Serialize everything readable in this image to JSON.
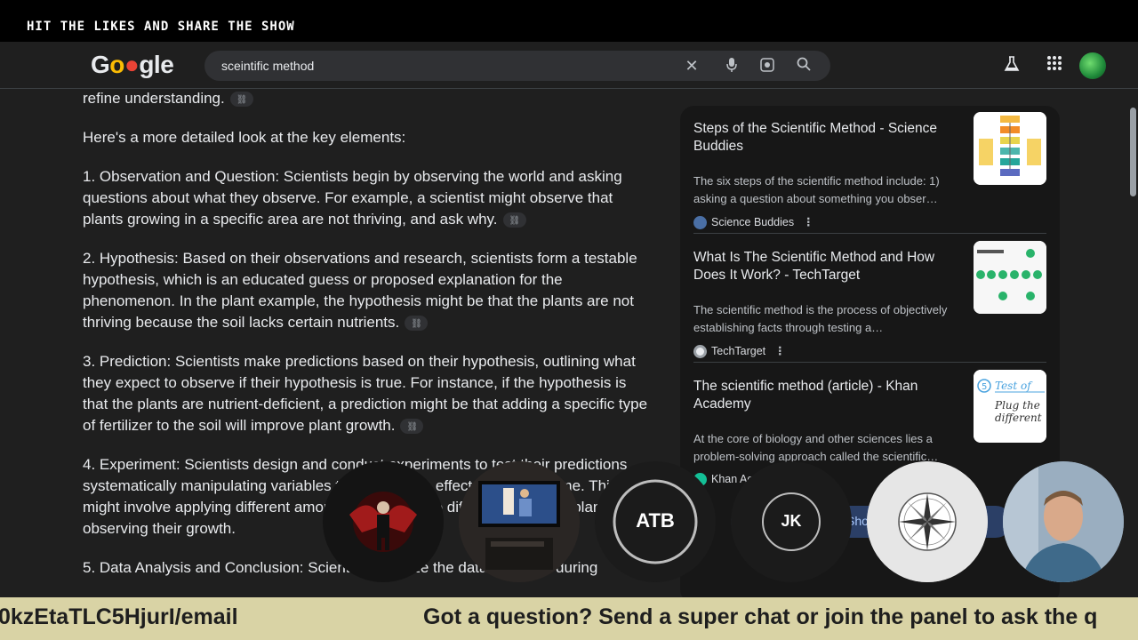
{
  "stream": {
    "banner": "HIT THE LIKES AND SHARE THE SHOW",
    "ticker_left": "0kzEtaTLC5HjurI/email",
    "ticker_right": "Got a question? Send a super chat or join the panel to ask the q"
  },
  "header": {
    "logo_text": "Google",
    "search_value": "sceintific method",
    "icons": [
      "close-icon",
      "mic-icon",
      "lens-icon",
      "search-icon",
      "labs-flask-icon",
      "apps-grid-icon",
      "account-avatar"
    ]
  },
  "main": {
    "paragraphs": [
      "refine understanding.",
      "Here's a more detailed look at the key elements:",
      "1. Observation and Question: Scientists begin by observing the world and asking questions about what they observe. For example, a scientist might observe that plants growing in a specific area are not thriving, and ask why.",
      "2. Hypothesis: Based on their observations and research, scientists form a testable hypothesis, which is an educated guess or proposed explanation for the phenomenon. In the plant example, the hypothesis might be that the plants are not thriving because the soil lacks certain nutrients.",
      "3. Prediction: Scientists make predictions based on their hypothesis, outlining what they expect to observe if their hypothesis is true. For instance, if the hypothesis is that the plants are nutrient-deficient, a prediction might be that adding a specific type of fertilizer to the soil will improve plant growth.",
      "4. Experiment: Scientists design and conduct experiments to test their predictions, systematically manipulating variables to observe the effect on the outcome. This might involve applying different amounts of fertilizer to different groups of plants and observing their growth.",
      "5. Data Analysis and Conclusion: Scientists analyze the data collected during"
    ]
  },
  "sources": [
    {
      "title": "Steps of the Scientific Method - Science Buddies",
      "snippet": "The six steps of the scientific method include: 1) asking a question about something you obser…",
      "site": "Science Buddies",
      "icon_color": "#4a6fa5"
    },
    {
      "title": "What Is The Scientific Method and How Does It Work? - TechTarget",
      "snippet": "The scientific method is the process of objectively establishing facts through testing a…",
      "site": "TechTarget",
      "icon_color": "#e8eaed"
    },
    {
      "title": "The scientific method (article) - Khan Academy",
      "snippet": "At the core of biology and other sciences lies a problem-solving approach called the scientific…",
      "site": "Khan Academy",
      "icon_color": "#14bf96"
    }
  ],
  "show_all_label": "Show all",
  "thumbnails": {
    "khan_text_1": "Test of",
    "khan_text_2": "Plug the",
    "khan_text_3": "different"
  },
  "participants": [
    {
      "name": "",
      "type": "avatar-image",
      "bg": "#1a1a1a"
    },
    {
      "name": "",
      "type": "video",
      "bg": "#2a2624"
    },
    {
      "name": "ATB",
      "type": "initials",
      "bg": "#1b1b1b"
    },
    {
      "name": "JK",
      "type": "initials",
      "bg": "#1b1b1b"
    },
    {
      "name": "",
      "type": "compass",
      "bg": "#e6e6e6"
    },
    {
      "name": "",
      "type": "video",
      "bg": "#8fa3b6"
    }
  ]
}
